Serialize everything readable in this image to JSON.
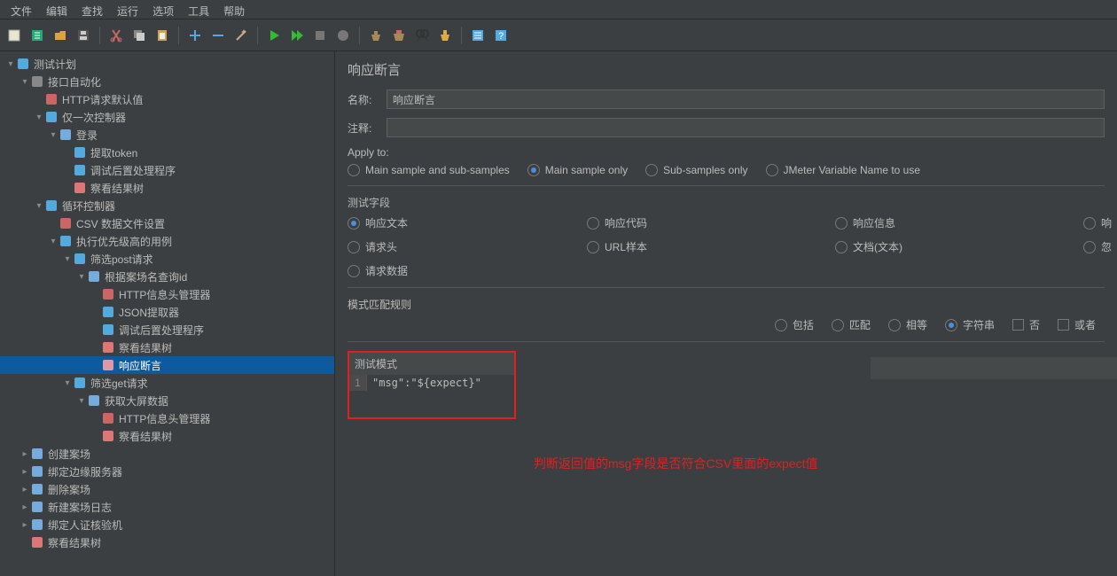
{
  "menu": [
    "文件",
    "编辑",
    "查找",
    "运行",
    "选项",
    "工具",
    "帮助"
  ],
  "tree": [
    {
      "d": 0,
      "e": "▾",
      "i": "flask",
      "t": "测试计划"
    },
    {
      "d": 1,
      "e": "▾",
      "i": "gear",
      "t": "接口自动化"
    },
    {
      "d": 2,
      "e": "",
      "i": "http",
      "t": "HTTP请求默认值"
    },
    {
      "d": 2,
      "e": "▾",
      "i": "ctrl",
      "t": "仅一次控制器"
    },
    {
      "d": 3,
      "e": "▾",
      "i": "req",
      "t": "登录"
    },
    {
      "d": 4,
      "e": "",
      "i": "extract",
      "t": "提取token"
    },
    {
      "d": 4,
      "e": "",
      "i": "post",
      "t": "调试后置处理程序"
    },
    {
      "d": 4,
      "e": "",
      "i": "result",
      "t": "察看结果树"
    },
    {
      "d": 2,
      "e": "▾",
      "i": "loop",
      "t": "循环控制器"
    },
    {
      "d": 3,
      "e": "",
      "i": "csv",
      "t": "CSV 数据文件设置"
    },
    {
      "d": 3,
      "e": "▾",
      "i": "ctrl",
      "t": "执行优先级高的用例"
    },
    {
      "d": 4,
      "e": "▾",
      "i": "switch",
      "t": "筛选post请求"
    },
    {
      "d": 5,
      "e": "▾",
      "i": "req",
      "t": "根据案场名查询id"
    },
    {
      "d": 6,
      "e": "",
      "i": "http",
      "t": "HTTP信息头管理器"
    },
    {
      "d": 6,
      "e": "",
      "i": "json",
      "t": "JSON提取器"
    },
    {
      "d": 6,
      "e": "",
      "i": "post",
      "t": "调试后置处理程序"
    },
    {
      "d": 6,
      "e": "",
      "i": "result",
      "t": "察看结果树"
    },
    {
      "d": 6,
      "e": "",
      "i": "assert",
      "t": "响应断言",
      "sel": true
    },
    {
      "d": 4,
      "e": "▾",
      "i": "switch",
      "t": "筛选get请求"
    },
    {
      "d": 5,
      "e": "▾",
      "i": "req",
      "t": "获取大屏数据"
    },
    {
      "d": 6,
      "e": "",
      "i": "http",
      "t": "HTTP信息头管理器"
    },
    {
      "d": 6,
      "e": "",
      "i": "result",
      "t": "察看结果树"
    },
    {
      "d": 1,
      "e": "▸",
      "i": "req",
      "t": "创建案场"
    },
    {
      "d": 1,
      "e": "▸",
      "i": "req",
      "t": "绑定边缘服务器"
    },
    {
      "d": 1,
      "e": "▸",
      "i": "req",
      "t": "删除案场"
    },
    {
      "d": 1,
      "e": "▸",
      "i": "req",
      "t": "新建案场日志"
    },
    {
      "d": 1,
      "e": "▸",
      "i": "req",
      "t": "绑定人证核验机"
    },
    {
      "d": 1,
      "e": "",
      "i": "result",
      "t": "察看结果树"
    }
  ],
  "panel": {
    "title": "响应断言",
    "name_label": "名称:",
    "name_value": "响应断言",
    "comment_label": "注释:",
    "comment_value": "",
    "apply_label": "Apply to:",
    "apply_opts": [
      "Main sample and sub-samples",
      "Main sample only",
      "Sub-samples only",
      "JMeter Variable Name to use"
    ],
    "apply_sel": 1,
    "field_label": "测试字段",
    "fields": [
      {
        "t": "响应文本",
        "c": true
      },
      {
        "t": "响应代码"
      },
      {
        "t": "响应信息"
      },
      {
        "t": "响"
      },
      {
        "t": "请求头"
      },
      {
        "t": "URL样本"
      },
      {
        "t": "文档(文本)"
      },
      {
        "t": "忽"
      },
      {
        "t": "请求数据"
      }
    ],
    "pattern_label": "模式匹配规则",
    "pattern_opts": [
      {
        "t": "包括",
        "type": "r"
      },
      {
        "t": "匹配",
        "type": "r"
      },
      {
        "t": "相等",
        "type": "r"
      },
      {
        "t": "字符串",
        "type": "r",
        "c": true
      },
      {
        "t": "否",
        "type": "c"
      },
      {
        "t": "或者",
        "type": "c"
      }
    ],
    "test_pattern_label": "测试模式",
    "pattern_value": "\"msg\":\"${expect}\"",
    "col_header": "测试模式",
    "annotation": "判断返回值的msg字段是否符合CSV里面的expect值"
  }
}
